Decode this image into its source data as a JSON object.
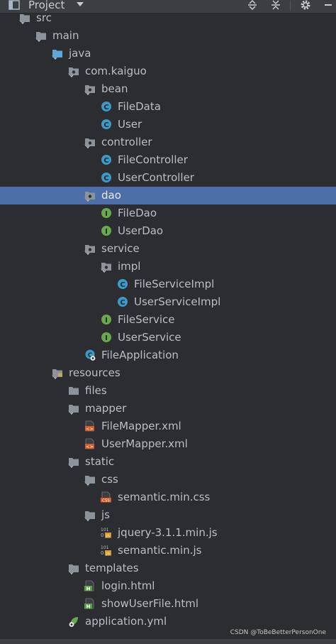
{
  "panel": {
    "title": "Project",
    "icons": {
      "view": "project-view-icon",
      "dropdown": "chevron-down-icon",
      "expand": "expand-all-icon",
      "collapse": "collapse-all-icon",
      "settings": "gear-icon"
    }
  },
  "colors": {
    "background": "#2b2d30",
    "selection": "#4c6ea9",
    "folder": "#8d939a",
    "source_folder": "#5ea6d8",
    "class": "#3d9ac6",
    "interface": "#6aa84f",
    "xml": "#d65b2a",
    "html": "#5a9e45"
  },
  "tree": [
    {
      "label": "src",
      "icon": "folder",
      "expanded": true
    },
    {
      "label": "main",
      "icon": "folder",
      "expanded": true
    },
    {
      "label": "java",
      "icon": "source-folder",
      "expanded": true
    },
    {
      "label": "com.kaiguo",
      "icon": "package",
      "expanded": true
    },
    {
      "label": "bean",
      "icon": "package",
      "expanded": true
    },
    {
      "label": "FileData",
      "icon": "class"
    },
    {
      "label": "User",
      "icon": "class"
    },
    {
      "label": "controller",
      "icon": "package",
      "expanded": true
    },
    {
      "label": "FileController",
      "icon": "class"
    },
    {
      "label": "UserController",
      "icon": "class"
    },
    {
      "label": "dao",
      "icon": "package",
      "expanded": true,
      "selected": true
    },
    {
      "label": "FileDao",
      "icon": "interface"
    },
    {
      "label": "UserDao",
      "icon": "interface"
    },
    {
      "label": "service",
      "icon": "package",
      "expanded": true
    },
    {
      "label": "impl",
      "icon": "package",
      "expanded": true
    },
    {
      "label": "FileServiceImpl",
      "icon": "class"
    },
    {
      "label": "UserServiceImpl",
      "icon": "class"
    },
    {
      "label": "FileService",
      "icon": "interface"
    },
    {
      "label": "UserService",
      "icon": "interface"
    },
    {
      "label": "FileApplication",
      "icon": "spring-boot-class"
    },
    {
      "label": "resources",
      "icon": "resources-folder",
      "expanded": true
    },
    {
      "label": "files",
      "icon": "folder"
    },
    {
      "label": "mapper",
      "icon": "folder",
      "expanded": true
    },
    {
      "label": "FileMapper.xml",
      "icon": "xml-file"
    },
    {
      "label": "UserMapper.xml",
      "icon": "xml-file"
    },
    {
      "label": "static",
      "icon": "folder",
      "expanded": true
    },
    {
      "label": "css",
      "icon": "folder",
      "expanded": true
    },
    {
      "label": "semantic.min.css",
      "icon": "css-file",
      "icon_text": "CSS"
    },
    {
      "label": "js",
      "icon": "folder",
      "expanded": true
    },
    {
      "label": "jquery-3.1.1.min.js",
      "icon": "js-file",
      "icon_text": "101 JS"
    },
    {
      "label": "semantic.min.js",
      "icon": "js-file",
      "icon_text": "101 JS"
    },
    {
      "label": "templates",
      "icon": "folder",
      "expanded": true
    },
    {
      "label": "login.html",
      "icon": "html-file",
      "icon_text": "H"
    },
    {
      "label": "showUserFile.html",
      "icon": "html-file",
      "icon_text": "H"
    },
    {
      "label": "application.yml",
      "icon": "yml-file"
    }
  ],
  "watermark": "CSDN @ToBeBetterPersonOne"
}
